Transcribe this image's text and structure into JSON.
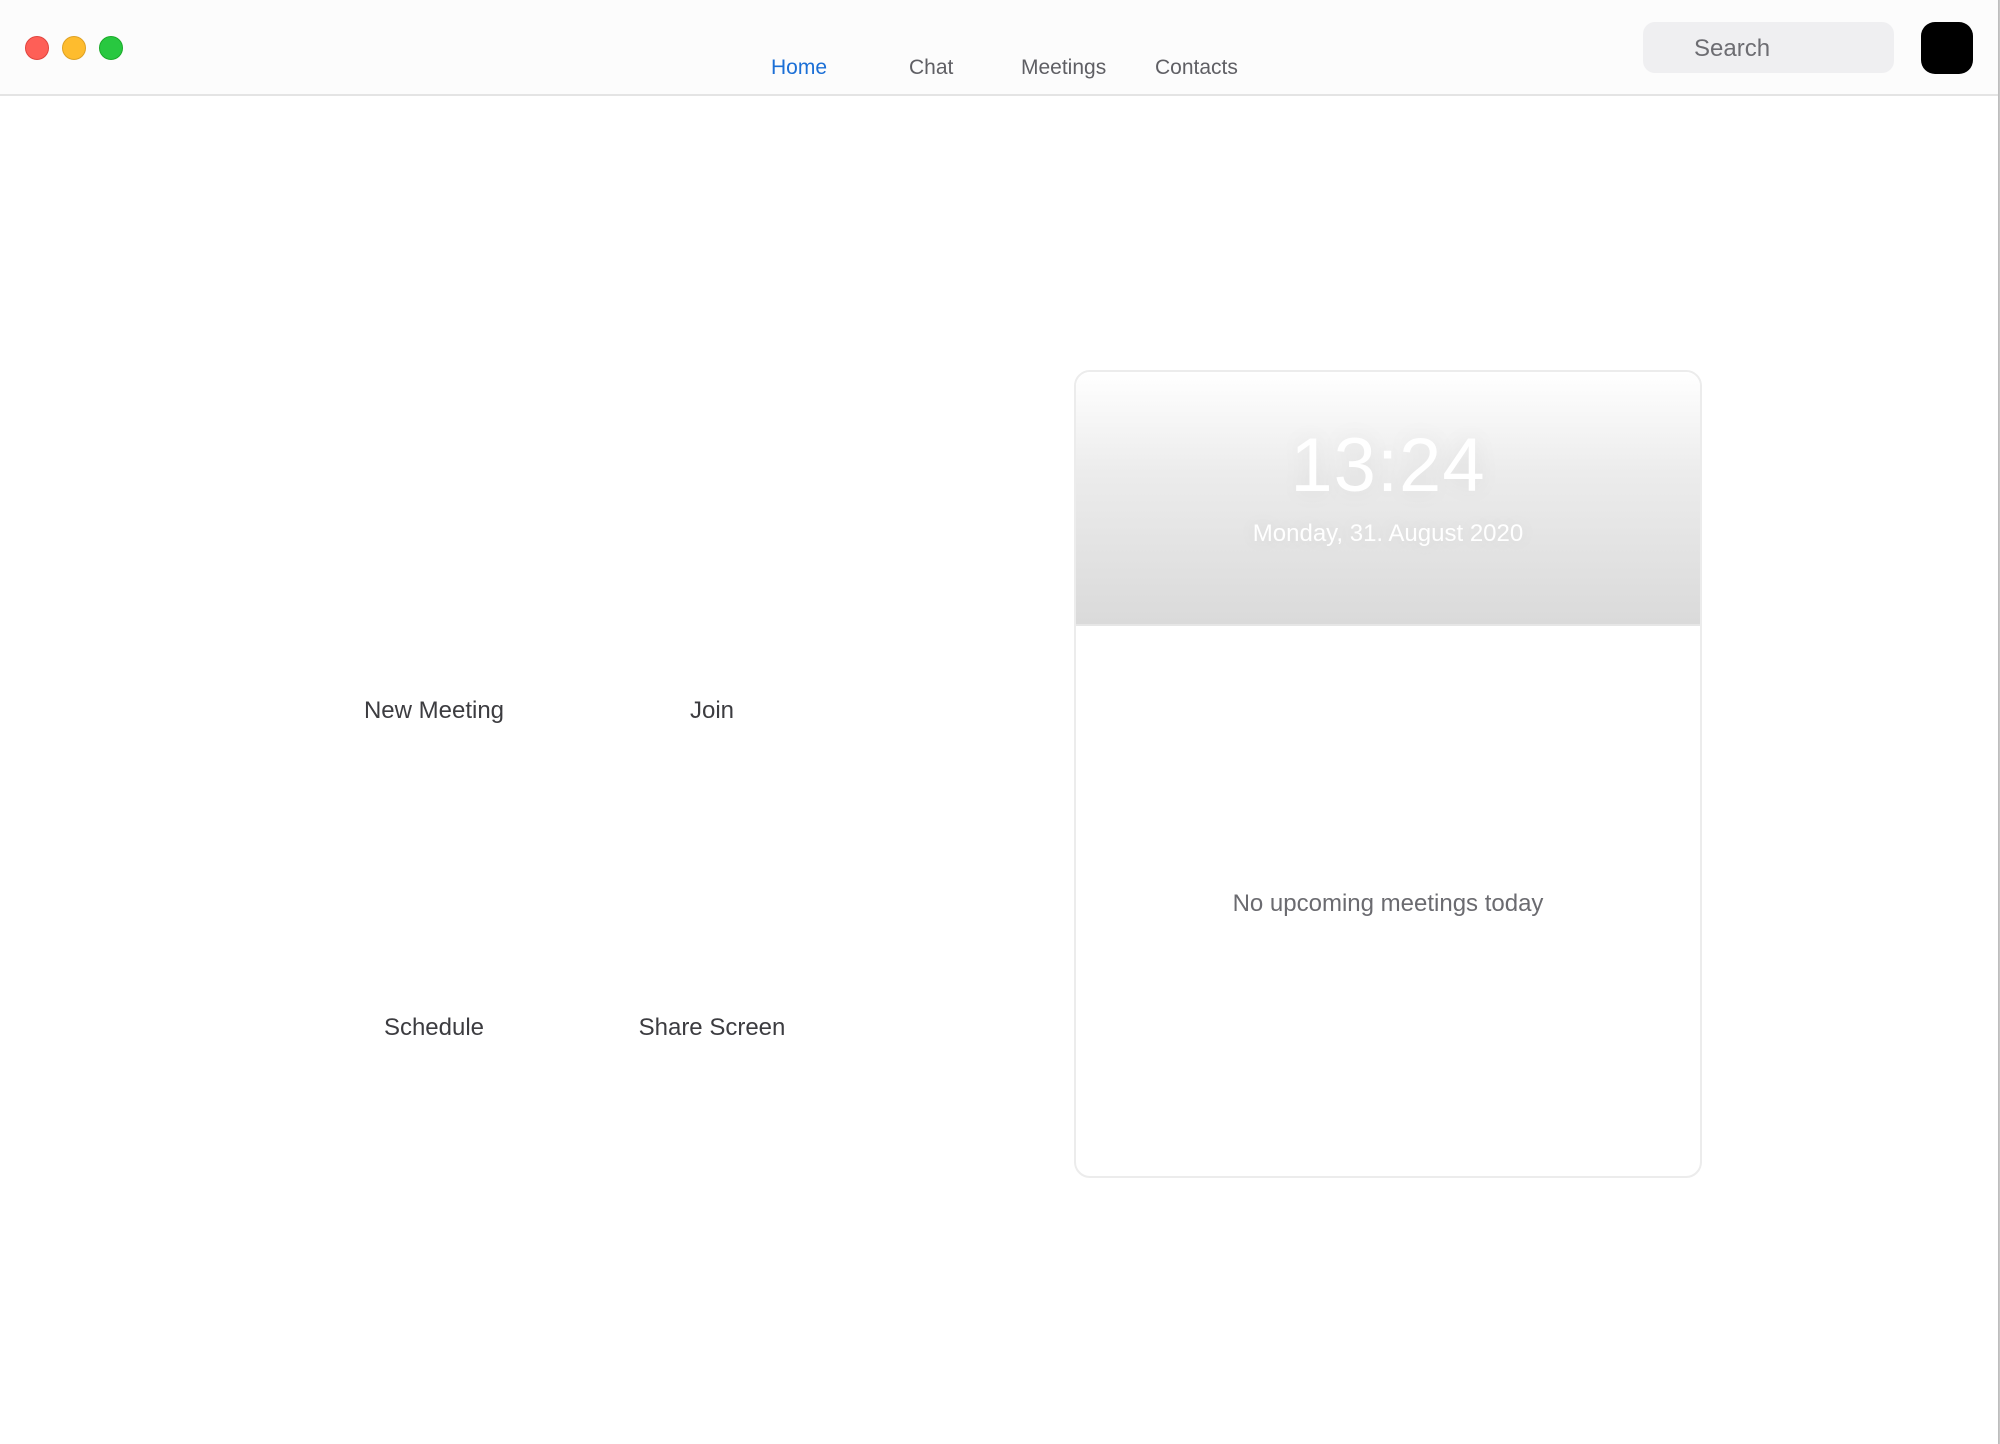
{
  "window": {
    "controls": {
      "close_color": "#fe5f57",
      "minimize_color": "#febc2e",
      "zoom_color": "#28c840"
    }
  },
  "nav": {
    "tabs": [
      {
        "label": "Home",
        "active": true
      },
      {
        "label": "Chat",
        "active": false
      },
      {
        "label": "Meetings",
        "active": false
      },
      {
        "label": "Contacts",
        "active": false
      }
    ],
    "active_color": "#1b6fd6"
  },
  "search": {
    "placeholder": "Search",
    "icon": "search-icon"
  },
  "actions": [
    {
      "label": "New Meeting"
    },
    {
      "label": "Join"
    },
    {
      "label": "Schedule"
    },
    {
      "label": "Share Screen"
    }
  ],
  "calendar": {
    "time": "13:24",
    "date": "Monday, 31. August 2020",
    "empty_message": "No upcoming meetings today"
  }
}
